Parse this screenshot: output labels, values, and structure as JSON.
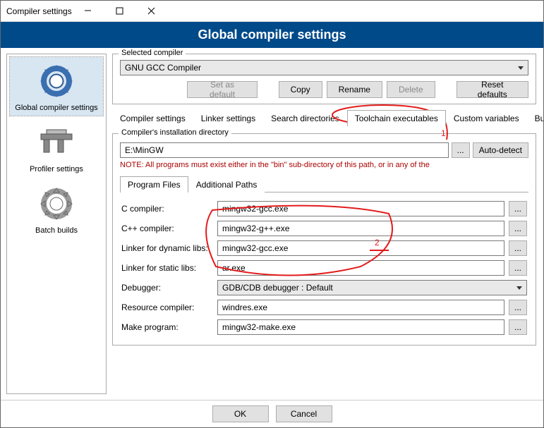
{
  "window": {
    "title": "Compiler settings"
  },
  "banner": "Global compiler settings",
  "sidebar": {
    "items": [
      {
        "label": "Global compiler settings"
      },
      {
        "label": "Profiler settings"
      },
      {
        "label": "Batch builds"
      }
    ]
  },
  "selected_compiler": {
    "legend": "Selected compiler",
    "value": "GNU GCC Compiler",
    "buttons": {
      "set_default": "Set as default",
      "copy": "Copy",
      "rename": "Rename",
      "delete": "Delete",
      "reset": "Reset defaults"
    }
  },
  "tabs": {
    "items": [
      "Compiler settings",
      "Linker settings",
      "Search directories",
      "Toolchain executables",
      "Custom variables",
      "Bui"
    ],
    "active_index": 3
  },
  "install_dir": {
    "legend": "Compiler's installation directory",
    "value": "E:\\MinGW",
    "browse": "...",
    "auto_detect": "Auto-detect",
    "note": "NOTE: All programs must exist either in the \"bin\" sub-directory of this path, or in any of the"
  },
  "inner_tabs": {
    "items": [
      "Program Files",
      "Additional Paths"
    ],
    "active_index": 0
  },
  "programs": {
    "c_compiler": {
      "label": "C compiler:",
      "value": "mingw32-gcc.exe"
    },
    "cpp_compiler": {
      "label": "C++ compiler:",
      "value": "mingw32-g++.exe"
    },
    "linker_dyn": {
      "label": "Linker for dynamic libs:",
      "value": "mingw32-gcc.exe"
    },
    "linker_static": {
      "label": "Linker for static libs:",
      "value": "ar.exe"
    },
    "debugger": {
      "label": "Debugger:",
      "value": "GDB/CDB debugger : Default"
    },
    "resource": {
      "label": "Resource compiler:",
      "value": "windres.exe"
    },
    "make": {
      "label": "Make program:",
      "value": "mingw32-make.exe"
    }
  },
  "footer": {
    "ok": "OK",
    "cancel": "Cancel"
  },
  "annotations": {
    "one": "1",
    "two": "2"
  }
}
